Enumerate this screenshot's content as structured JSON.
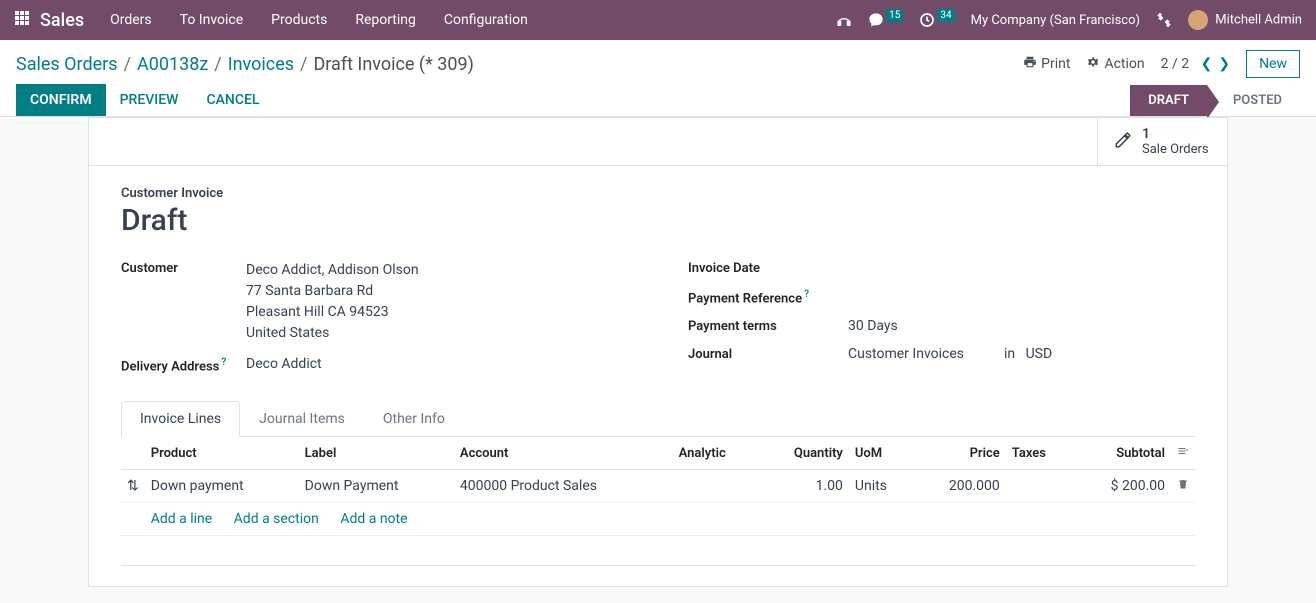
{
  "nav": {
    "app_name": "Sales",
    "menu": [
      "Orders",
      "To Invoice",
      "Products",
      "Reporting",
      "Configuration"
    ],
    "messages_count": "15",
    "activities_count": "34",
    "company": "My Company (San Francisco)",
    "user": "Mitchell Admin"
  },
  "breadcrumb": {
    "items": [
      "Sales Orders",
      "A00138z",
      "Invoices"
    ],
    "active": "Draft Invoice (* 309)"
  },
  "cp": {
    "print": "Print",
    "action": "Action",
    "pager": "2 / 2",
    "new": "New"
  },
  "statusbar": {
    "confirm": "CONFIRM",
    "preview": "PREVIEW",
    "cancel": "CANCEL",
    "draft": "DRAFT",
    "posted": "POSTED"
  },
  "stat": {
    "count": "1",
    "label": "Sale Orders"
  },
  "form": {
    "doc_type": "Customer Invoice",
    "title": "Draft",
    "customer_label": "Customer",
    "customer_name": "Deco Addict, Addison Olson",
    "customer_addr1": "77 Santa Barbara Rd",
    "customer_addr2": "Pleasant Hill CA 94523",
    "customer_country": "United States",
    "delivery_label": "Delivery Address",
    "delivery_value": "Deco Addict",
    "invoice_date_label": "Invoice Date",
    "payment_ref_label": "Payment Reference",
    "payment_terms_label": "Payment terms",
    "payment_terms_value": "30 Days",
    "journal_label": "Journal",
    "journal_value": "Customer Invoices",
    "journal_in": "in",
    "journal_currency": "USD"
  },
  "tabs": {
    "lines": "Invoice Lines",
    "items": "Journal Items",
    "other": "Other Info"
  },
  "table": {
    "headers": {
      "product": "Product",
      "label": "Label",
      "account": "Account",
      "analytic": "Analytic",
      "quantity": "Quantity",
      "uom": "UoM",
      "price": "Price",
      "taxes": "Taxes",
      "subtotal": "Subtotal"
    },
    "rows": [
      {
        "product": "Down payment",
        "label": "Down Payment",
        "account": "400000 Product Sales",
        "analytic": "",
        "quantity": "1.00",
        "uom": "Units",
        "price": "200.000",
        "taxes": "",
        "subtotal": "$ 200.00"
      }
    ],
    "add_line": "Add a line",
    "add_section": "Add a section",
    "add_note": "Add a note"
  }
}
